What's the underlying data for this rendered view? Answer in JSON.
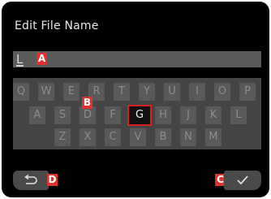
{
  "header": {
    "title": "Edit File Name"
  },
  "field": {
    "value": "L"
  },
  "keyboard": {
    "row1": [
      "Q",
      "W",
      "E",
      "R",
      "T",
      "Y",
      "U",
      "I",
      "O",
      "P"
    ],
    "row2": [
      "A",
      "S",
      "D",
      "F",
      "G",
      "H",
      "J",
      "K",
      "L"
    ],
    "row3": [
      "Z",
      "X",
      "C",
      "V",
      "B",
      "N",
      "M"
    ],
    "selected_key": "G"
  },
  "markers": {
    "a": "A",
    "b": "B",
    "c": "C",
    "d": "D"
  },
  "buttons": {
    "back_icon": "back-arrow-icon",
    "confirm_icon": "checkmark-icon"
  },
  "colors": {
    "background": "#000000",
    "key": "#595959",
    "selected_border": "#d42222",
    "marker": "#e0312e"
  }
}
